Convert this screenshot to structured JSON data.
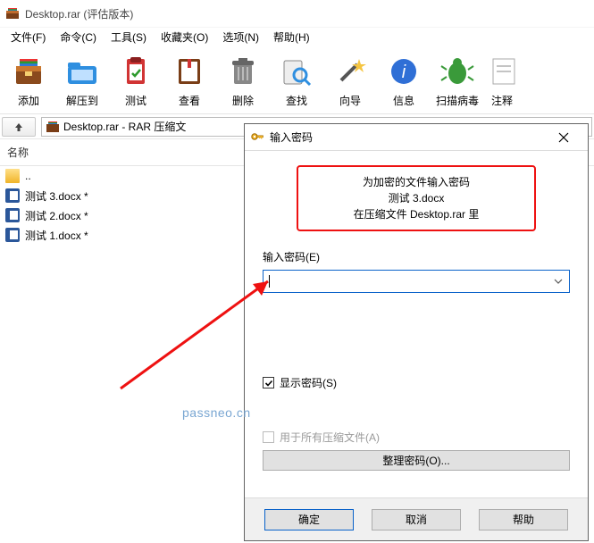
{
  "window": {
    "title": "Desktop.rar (评估版本)"
  },
  "menu": {
    "file": "文件(F)",
    "cmd": "命令(C)",
    "tools": "工具(S)",
    "fav": "收藏夹(O)",
    "opt": "选项(N)",
    "help": "帮助(H)"
  },
  "toolbar": {
    "add": "添加",
    "extract": "解压到",
    "test": "测试",
    "view": "查看",
    "delete": "删除",
    "find": "查找",
    "wizard": "向导",
    "info": "信息",
    "scan": "扫描病毒",
    "comment": "注释"
  },
  "addr": {
    "path": "Desktop.rar - RAR 压缩文"
  },
  "list": {
    "head": "名称",
    "rows": [
      {
        "name": "..",
        "icon": "folder"
      },
      {
        "name": "测试 3.docx *",
        "icon": "doc"
      },
      {
        "name": "测试 2.docx *",
        "icon": "doc"
      },
      {
        "name": "测试 1.docx *",
        "icon": "doc"
      }
    ]
  },
  "dialog": {
    "title": "输入密码",
    "notice_l1": "为加密的文件输入密码",
    "notice_l2": "测试 3.docx",
    "notice_l3": "在压缩文件 Desktop.rar 里",
    "pw_label": "输入密码(E)",
    "show_pw": "显示密码(S)",
    "for_all": "用于所有压缩文件(A)",
    "organize": "整理密码(O)...",
    "ok": "确定",
    "cancel": "取消",
    "help": "帮助"
  },
  "watermark": "passneo.cn"
}
